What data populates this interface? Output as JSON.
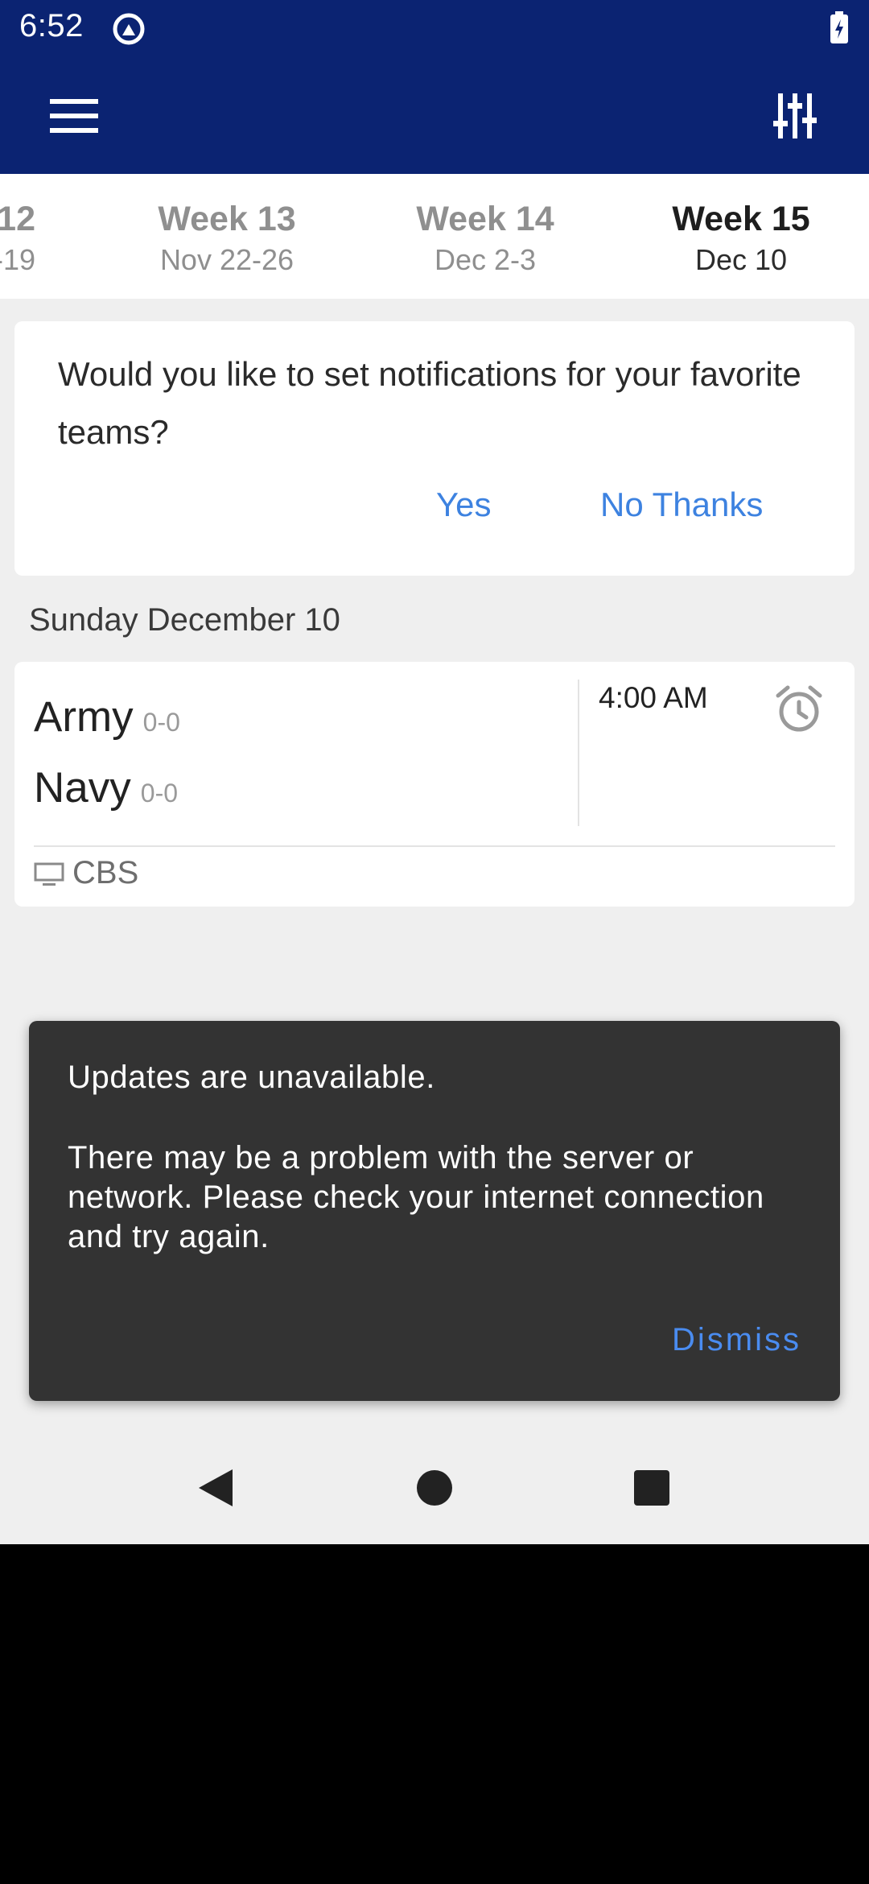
{
  "status_bar": {
    "time": "6:52"
  },
  "weeks": [
    {
      "label": "12",
      "dates": "-19",
      "active": false
    },
    {
      "label": "Week 13",
      "dates": "Nov 22-26",
      "active": false
    },
    {
      "label": "Week 14",
      "dates": "Dec 2-3",
      "active": false
    },
    {
      "label": "Week 15",
      "dates": "Dec 10",
      "active": true
    }
  ],
  "notification_prompt": {
    "text": "Would you like to set notifications for your favorite teams?",
    "yes_label": "Yes",
    "no_label": "No Thanks"
  },
  "day_header": "Sunday December 10",
  "game": {
    "team1": {
      "name": "Army",
      "record": "0-0"
    },
    "team2": {
      "name": "Navy",
      "record": "0-0"
    },
    "time": "4:00 AM",
    "network": "CBS"
  },
  "snackbar": {
    "title": "Updates are unavailable.",
    "body": "There may be a problem with the server or network. Please check your internet connection and try again.",
    "dismiss_label": "Dismiss"
  },
  "colors": {
    "app_bar": "#0b2372",
    "accent": "#3d82e0",
    "snackbar_bg": "#333333",
    "background": "#efefef"
  },
  "icons": [
    "menu-icon",
    "filter-sliders-icon",
    "alarm-clock-icon",
    "tv-icon",
    "back-icon",
    "home-icon",
    "recents-icon"
  ]
}
